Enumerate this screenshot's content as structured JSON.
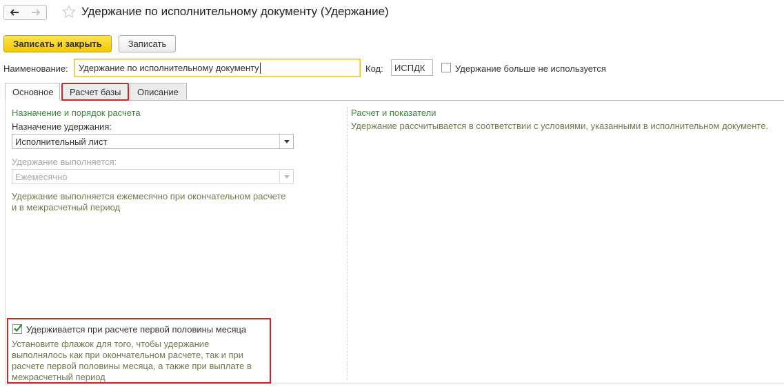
{
  "window": {
    "title": "Удержание по исполнительному документу (Удержание)"
  },
  "toolbar": {
    "save_close_label": "Записать и закрыть",
    "save_label": "Записать"
  },
  "form": {
    "name_label": "Наименование:",
    "name_value": "Удержание по исполнительному документу",
    "code_label": "Код:",
    "code_value": "ИСПДК",
    "unused_label": "Удержание больше не используется",
    "unused_checked": false
  },
  "tabs": [
    {
      "label": "Основное",
      "active": true
    },
    {
      "label": "Расчет базы",
      "active": false
    },
    {
      "label": "Описание",
      "active": false
    }
  ],
  "left": {
    "section_title": "Назначение и порядок расчета",
    "purpose_label": "Назначение удержания:",
    "purpose_value": "Исполнительный лист",
    "performed_label": "Удержание выполняется:",
    "performed_value": "Ежемесячно",
    "performed_hint_line1": "Удержание выполняется ежемесячно при окончательном расчете",
    "performed_hint_line2": "и в межрасчетный период",
    "first_half_label": "Удерживается при расчете первой половины месяца",
    "first_half_checked": true,
    "first_half_hint_line1": "Установите флажок для того, чтобы удержание",
    "first_half_hint_line2": "выполнялось как при окончательном расчете, так и при",
    "first_half_hint_line3": "расчете первой половины месяца, а также при выплате в",
    "first_half_hint_line4": "межрасчетный период"
  },
  "right": {
    "section_title": "Расчет и показатели",
    "hint": "Удержание рассчитывается в соответствии с условиями, указанными в исполнительном документе."
  },
  "colors": {
    "primary_button": "#f2c900",
    "highlight_border": "#d3242c",
    "section_title": "#3c8a3c",
    "hint_text": "#6f7a52"
  },
  "icons": {
    "back": "arrow-left-icon",
    "forward": "arrow-right-icon",
    "favorite": "star-icon",
    "dropdown": "chevron-down-icon",
    "check": "checkmark-icon"
  }
}
